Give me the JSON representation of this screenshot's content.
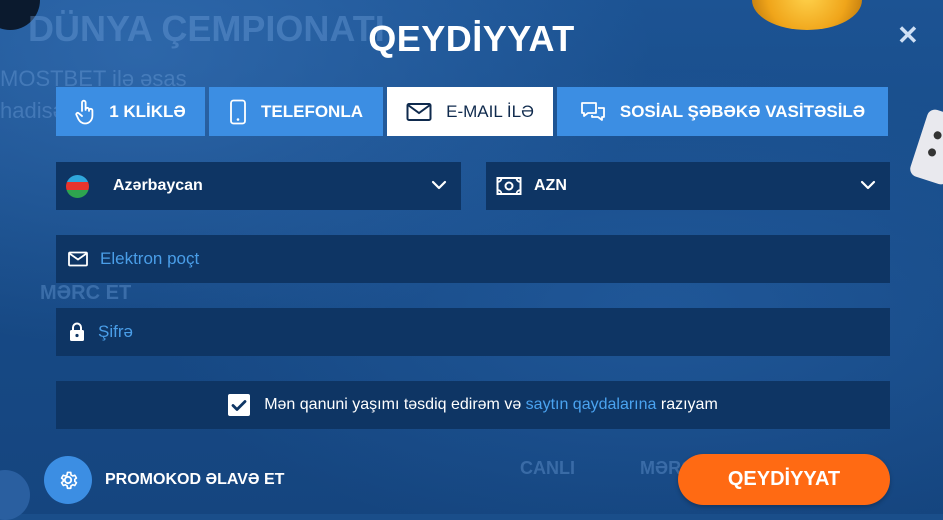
{
  "background": {
    "line1": "DÜNYA ÇEMPIONATI",
    "line2": "MOSTBET ilə əsas",
    "line3": "hadisələrə mərc et",
    "line4": "MƏRC ET",
    "line5": "CANLI",
    "line6": "MƏRC"
  },
  "modal": {
    "title": "QEYDİYYAT",
    "close_icon": "close-icon"
  },
  "tabs": [
    {
      "label": "1 KLİKLƏ",
      "icon": "hand-pointer-icon",
      "active": false
    },
    {
      "label": "TELEFONLA",
      "icon": "smartphone-icon",
      "active": false
    },
    {
      "label": "E-MAIL İLƏ",
      "icon": "envelope-icon",
      "active": true
    },
    {
      "label": "SOSİAL ŞƏBƏKƏ VASİTƏSİLƏ",
      "icon": "chat-bubbles-icon",
      "active": false
    }
  ],
  "country_select": {
    "value": "Azərbaycan",
    "icon": "azerbaijan-flag-icon"
  },
  "currency_select": {
    "value": "AZN",
    "icon": "banknote-icon"
  },
  "email_field": {
    "placeholder": "Elektron poçt",
    "value": ""
  },
  "password_field": {
    "placeholder": "Şifrə",
    "value": ""
  },
  "agreement": {
    "checked": true,
    "text_before": "Mən qanuni yaşımı təsdiq edirəm və",
    "link_text": "saytın qaydalarına",
    "text_after": "razıyam"
  },
  "promo": {
    "label": "PROMOKOD ƏLAVƏ ET",
    "icon": "gear-icon"
  },
  "submit": {
    "label": "QEYDİYYAT"
  },
  "colors": {
    "background": "#1a4e8a",
    "tab": "#3c8ee3",
    "field": "#0e3564",
    "submit": "#ff6a13",
    "link": "#4aa3f0"
  }
}
